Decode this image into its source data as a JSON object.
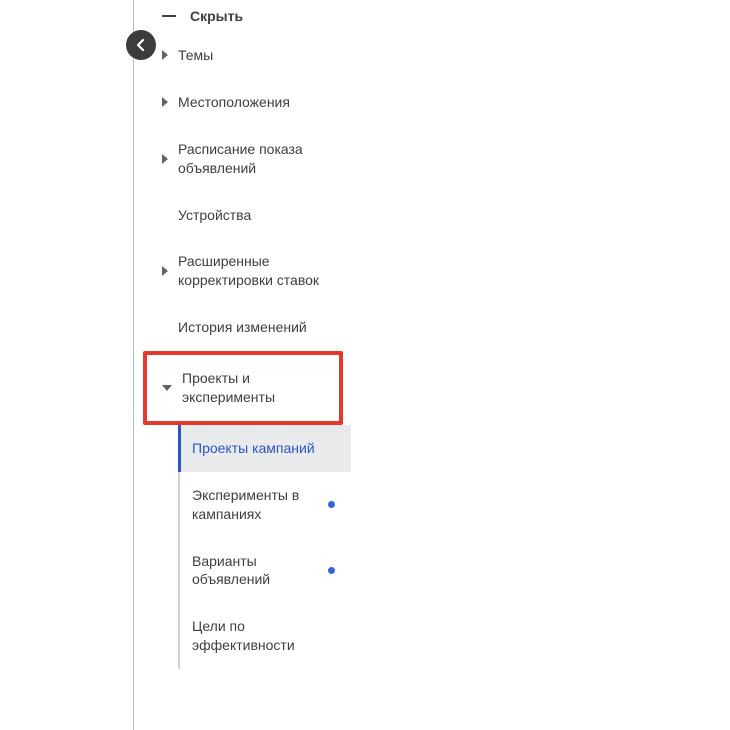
{
  "hide_label": "Скрыть",
  "nav": {
    "themes": "Темы",
    "locations": "Местоположения",
    "schedule": "Расписание показа объявлений",
    "devices": "Устройства",
    "bid_adjustments": "Расширенные корректировки ставок",
    "history": "История изменений",
    "drafts_experiments": "Проекты и эксперименты"
  },
  "sub": {
    "campaign_drafts": "Проекты кампаний",
    "campaign_experiments": "Эксперименты в кампаниях",
    "ad_variants": "Варианты объявлений",
    "performance_goals": "Цели по эффективности"
  }
}
